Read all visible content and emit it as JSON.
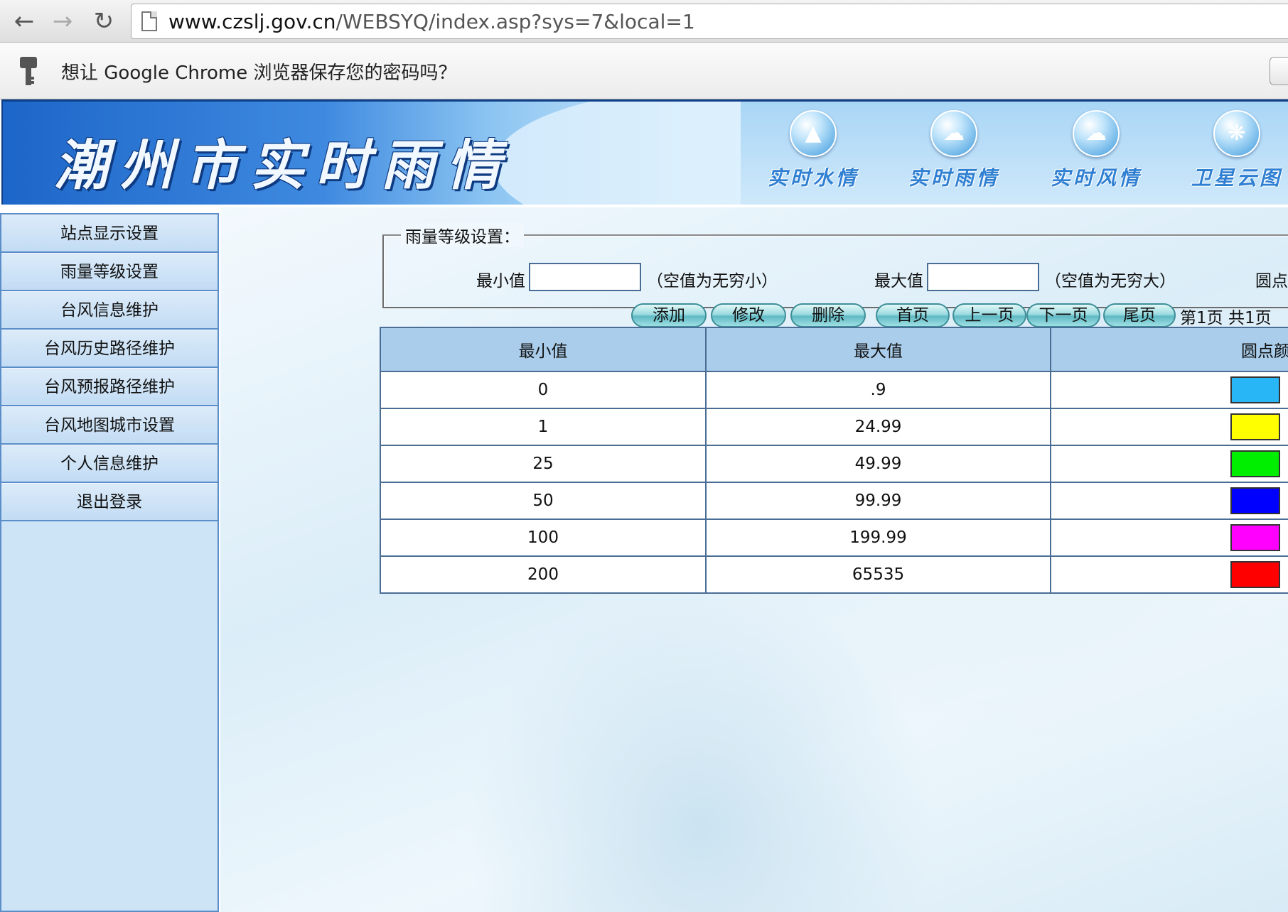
{
  "browser": {
    "url_domain": "www.czslj.gov.cn",
    "url_path": "/WEBSYQ/index.asp?sys=7&local=1",
    "infobar_text": "想让 Google Chrome 浏览器保存您的密码吗？",
    "infobar_button": "口"
  },
  "banner": {
    "site_title": "潮州市实时雨情",
    "nav": [
      {
        "label": "实时水情",
        "icon": "mountain-water-icon"
      },
      {
        "label": "实时雨情",
        "icon": "rain-cloud-icon"
      },
      {
        "label": "实时风情",
        "icon": "wind-cloud-icon"
      },
      {
        "label": "卫星云图",
        "icon": "satellite-swirl-icon"
      }
    ]
  },
  "sidebar": {
    "items": [
      {
        "label": "站点显示设置"
      },
      {
        "label": "雨量等级设置"
      },
      {
        "label": "台风信息维护"
      },
      {
        "label": "台风历史路径维护"
      },
      {
        "label": "台风预报路径维护"
      },
      {
        "label": "台风地图城市设置"
      },
      {
        "label": "个人信息维护"
      },
      {
        "label": "退出登录"
      }
    ]
  },
  "form": {
    "legend": "雨量等级设置：",
    "min_label": "最小值",
    "min_value": "",
    "min_hint": "（空值为无穷小）",
    "max_label": "最大值",
    "max_value": "",
    "max_hint": "（空值为无穷大）",
    "color_label": "圆点"
  },
  "buttons": {
    "add": "添加",
    "edit": "修改",
    "delete": "删除",
    "first": "首页",
    "prev": "上一页",
    "next": "下一页",
    "last": "尾页"
  },
  "pager": {
    "info": "第1页 共1页"
  },
  "table": {
    "headers": [
      "最小值",
      "最大值",
      "圆点颜"
    ],
    "rows": [
      {
        "min": "0",
        "max": ".9",
        "color": "#29b6f6"
      },
      {
        "min": "1",
        "max": "24.99",
        "color": "#ffff00"
      },
      {
        "min": "25",
        "max": "49.99",
        "color": "#00ee00"
      },
      {
        "min": "50",
        "max": "99.99",
        "color": "#0000ff"
      },
      {
        "min": "100",
        "max": "199.99",
        "color": "#ff00ff"
      },
      {
        "min": "200",
        "max": "65535",
        "color": "#ff0000"
      }
    ]
  }
}
